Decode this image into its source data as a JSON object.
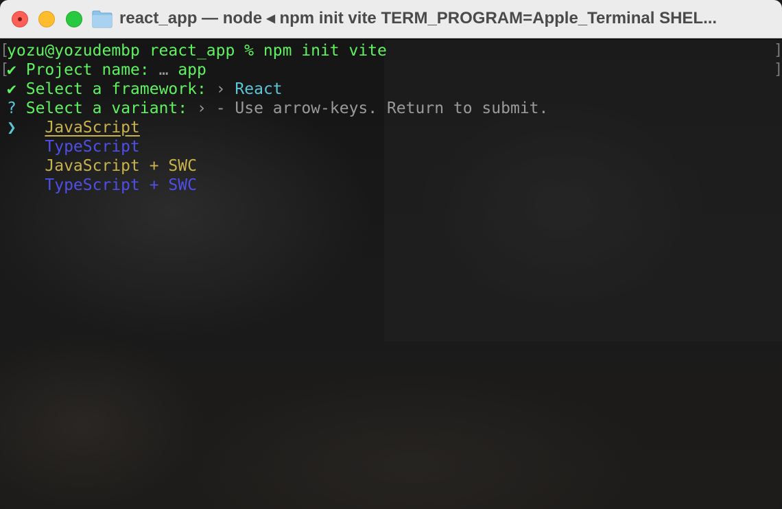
{
  "window": {
    "title": "react_app — node ◂ npm init vite TERM_PROGRAM=Apple_Terminal SHEL..."
  },
  "terminal": {
    "prompt": "yozu@yozudembp react_app % npm init vite",
    "project_name": {
      "check": "✔",
      "label": "Project name:",
      "sep": "…",
      "value": "app"
    },
    "framework": {
      "check": "✔",
      "label": "Select a framework:",
      "sep": "›",
      "value": "React"
    },
    "variant": {
      "q": "?",
      "label": "Select a variant:",
      "sep": "›",
      "hint": "- Use arrow-keys. Return to submit."
    },
    "cursor": "❯",
    "options": [
      {
        "label": "JavaScript",
        "selected": true
      },
      {
        "label": "TypeScript",
        "selected": false
      },
      {
        "label": "JavaScript + SWC",
        "selected": false
      },
      {
        "label": "TypeScript + SWC",
        "selected": false
      }
    ]
  },
  "colors": {
    "green": "#5ff25f",
    "cyan": "#5bc4d6",
    "yellow": "#c8b24a",
    "blue": "#4f4fe8"
  }
}
